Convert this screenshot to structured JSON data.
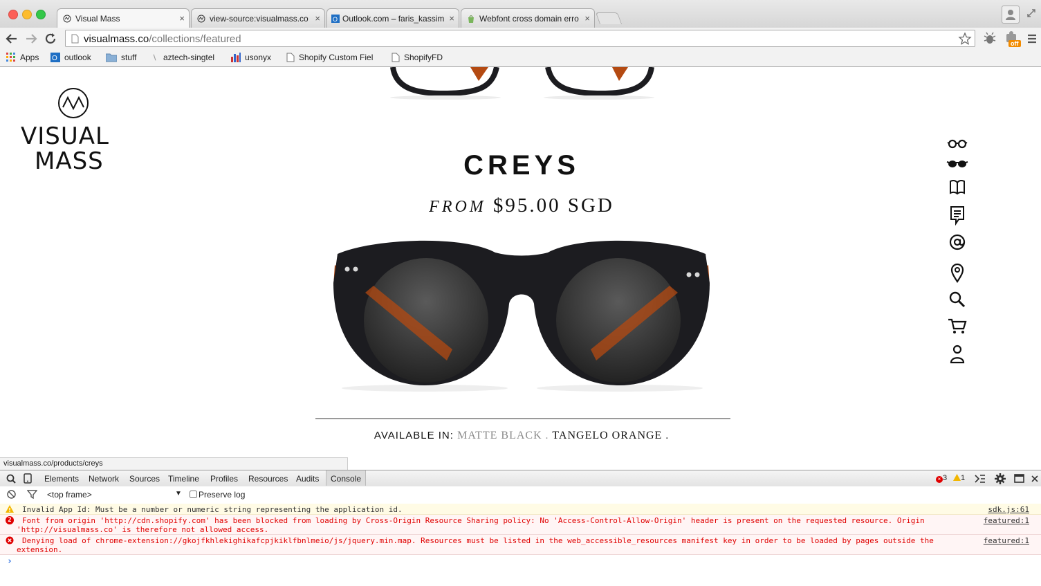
{
  "browser": {
    "tabs": [
      {
        "title": "Visual Mass"
      },
      {
        "title": "view-source:visualmass.co"
      },
      {
        "title": "Outlook.com – faris_kassim"
      },
      {
        "title": "Webfont cross domain erro"
      }
    ],
    "url_domain": "visualmass.co",
    "url_path": "/collections/featured",
    "bookmarks": [
      "Apps",
      "outlook",
      "stuff",
      "aztech-singtel",
      "usonyx",
      "Shopify Custom Fiel",
      "ShopifyFD"
    ],
    "extension_badge": "off"
  },
  "page": {
    "logo": {
      "line1": "VISUAL",
      "line2": "MASS"
    },
    "product": {
      "name": "CREYS",
      "price_prefix": "FROM",
      "price": "$95.00 SGD",
      "available_label": "AVAILABLE IN:",
      "colors": [
        {
          "name": "MATTE BLACK",
          "active": false
        },
        {
          "name": "TANGELO ORANGE",
          "active": true
        }
      ],
      "separator": "."
    },
    "side_nav": [
      "optical-icon",
      "sunglasses-icon",
      "book-icon",
      "notes-icon",
      "at-icon",
      "location-icon",
      "search-icon",
      "cart-icon",
      "account-icon"
    ]
  },
  "status_url": "visualmass.co/products/creys",
  "devtools": {
    "tabs": [
      "Elements",
      "Network",
      "Sources",
      "Timeline",
      "Profiles",
      "Resources",
      "Audits",
      "Console"
    ],
    "active_tab": "Console",
    "error_count": "3",
    "warning_count": "1",
    "frame": "<top frame>",
    "preserve_log": "Preserve log",
    "messages": [
      {
        "level": "warning",
        "count": "",
        "lines": [
          "Invalid App Id: Must be a number or numeric string representing the application id."
        ],
        "source": "sdk.js:61"
      },
      {
        "level": "error",
        "count": "2",
        "lines": [
          "Font from origin 'http://cdn.shopify.com' has been blocked from loading by Cross-Origin Resource Sharing policy: No 'Access-Control-Allow-Origin' header is present on the requested resource. Origin",
          "'http://visualmass.co' is therefore not allowed access."
        ],
        "source": "featured:1"
      },
      {
        "level": "error",
        "count": "",
        "lines": [
          "Denying load of chrome-extension://gkojfkhlekighikafcpjkiklfbnlmeio/js/jquery.min.map. Resources must be listed in the web_accessible_resources manifest key in order to be loaded by pages outside the",
          "extension."
        ],
        "source": "featured:1"
      }
    ],
    "prompt": "›"
  },
  "colors": {
    "error": "#e00000",
    "frame_black": "#1c1c20",
    "temple_orange": "#b44a12",
    "color_inactive": "#8a8a8a"
  }
}
